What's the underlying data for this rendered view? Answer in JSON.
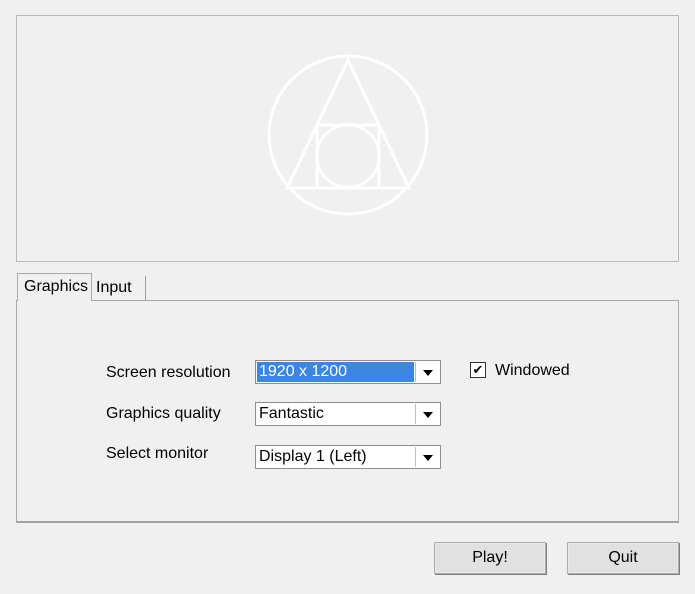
{
  "tabs": [
    {
      "label": "Graphics",
      "active": true
    },
    {
      "label": "Input",
      "active": false
    }
  ],
  "graphics": {
    "screen_resolution": {
      "label": "Screen resolution",
      "value": "1920 x 1200"
    },
    "graphics_quality": {
      "label": "Graphics quality",
      "value": "Fantastic"
    },
    "select_monitor": {
      "label": "Select monitor",
      "value": "Display 1 (Left)"
    },
    "windowed": {
      "label": "Windowed",
      "checked": true,
      "check_glyph": "✔"
    }
  },
  "buttons": {
    "play": "Play!",
    "quit": "Quit"
  },
  "banner": {
    "logo_icon": "circle-triangle-square-logo-icon",
    "logo_color": "#ffffff"
  }
}
